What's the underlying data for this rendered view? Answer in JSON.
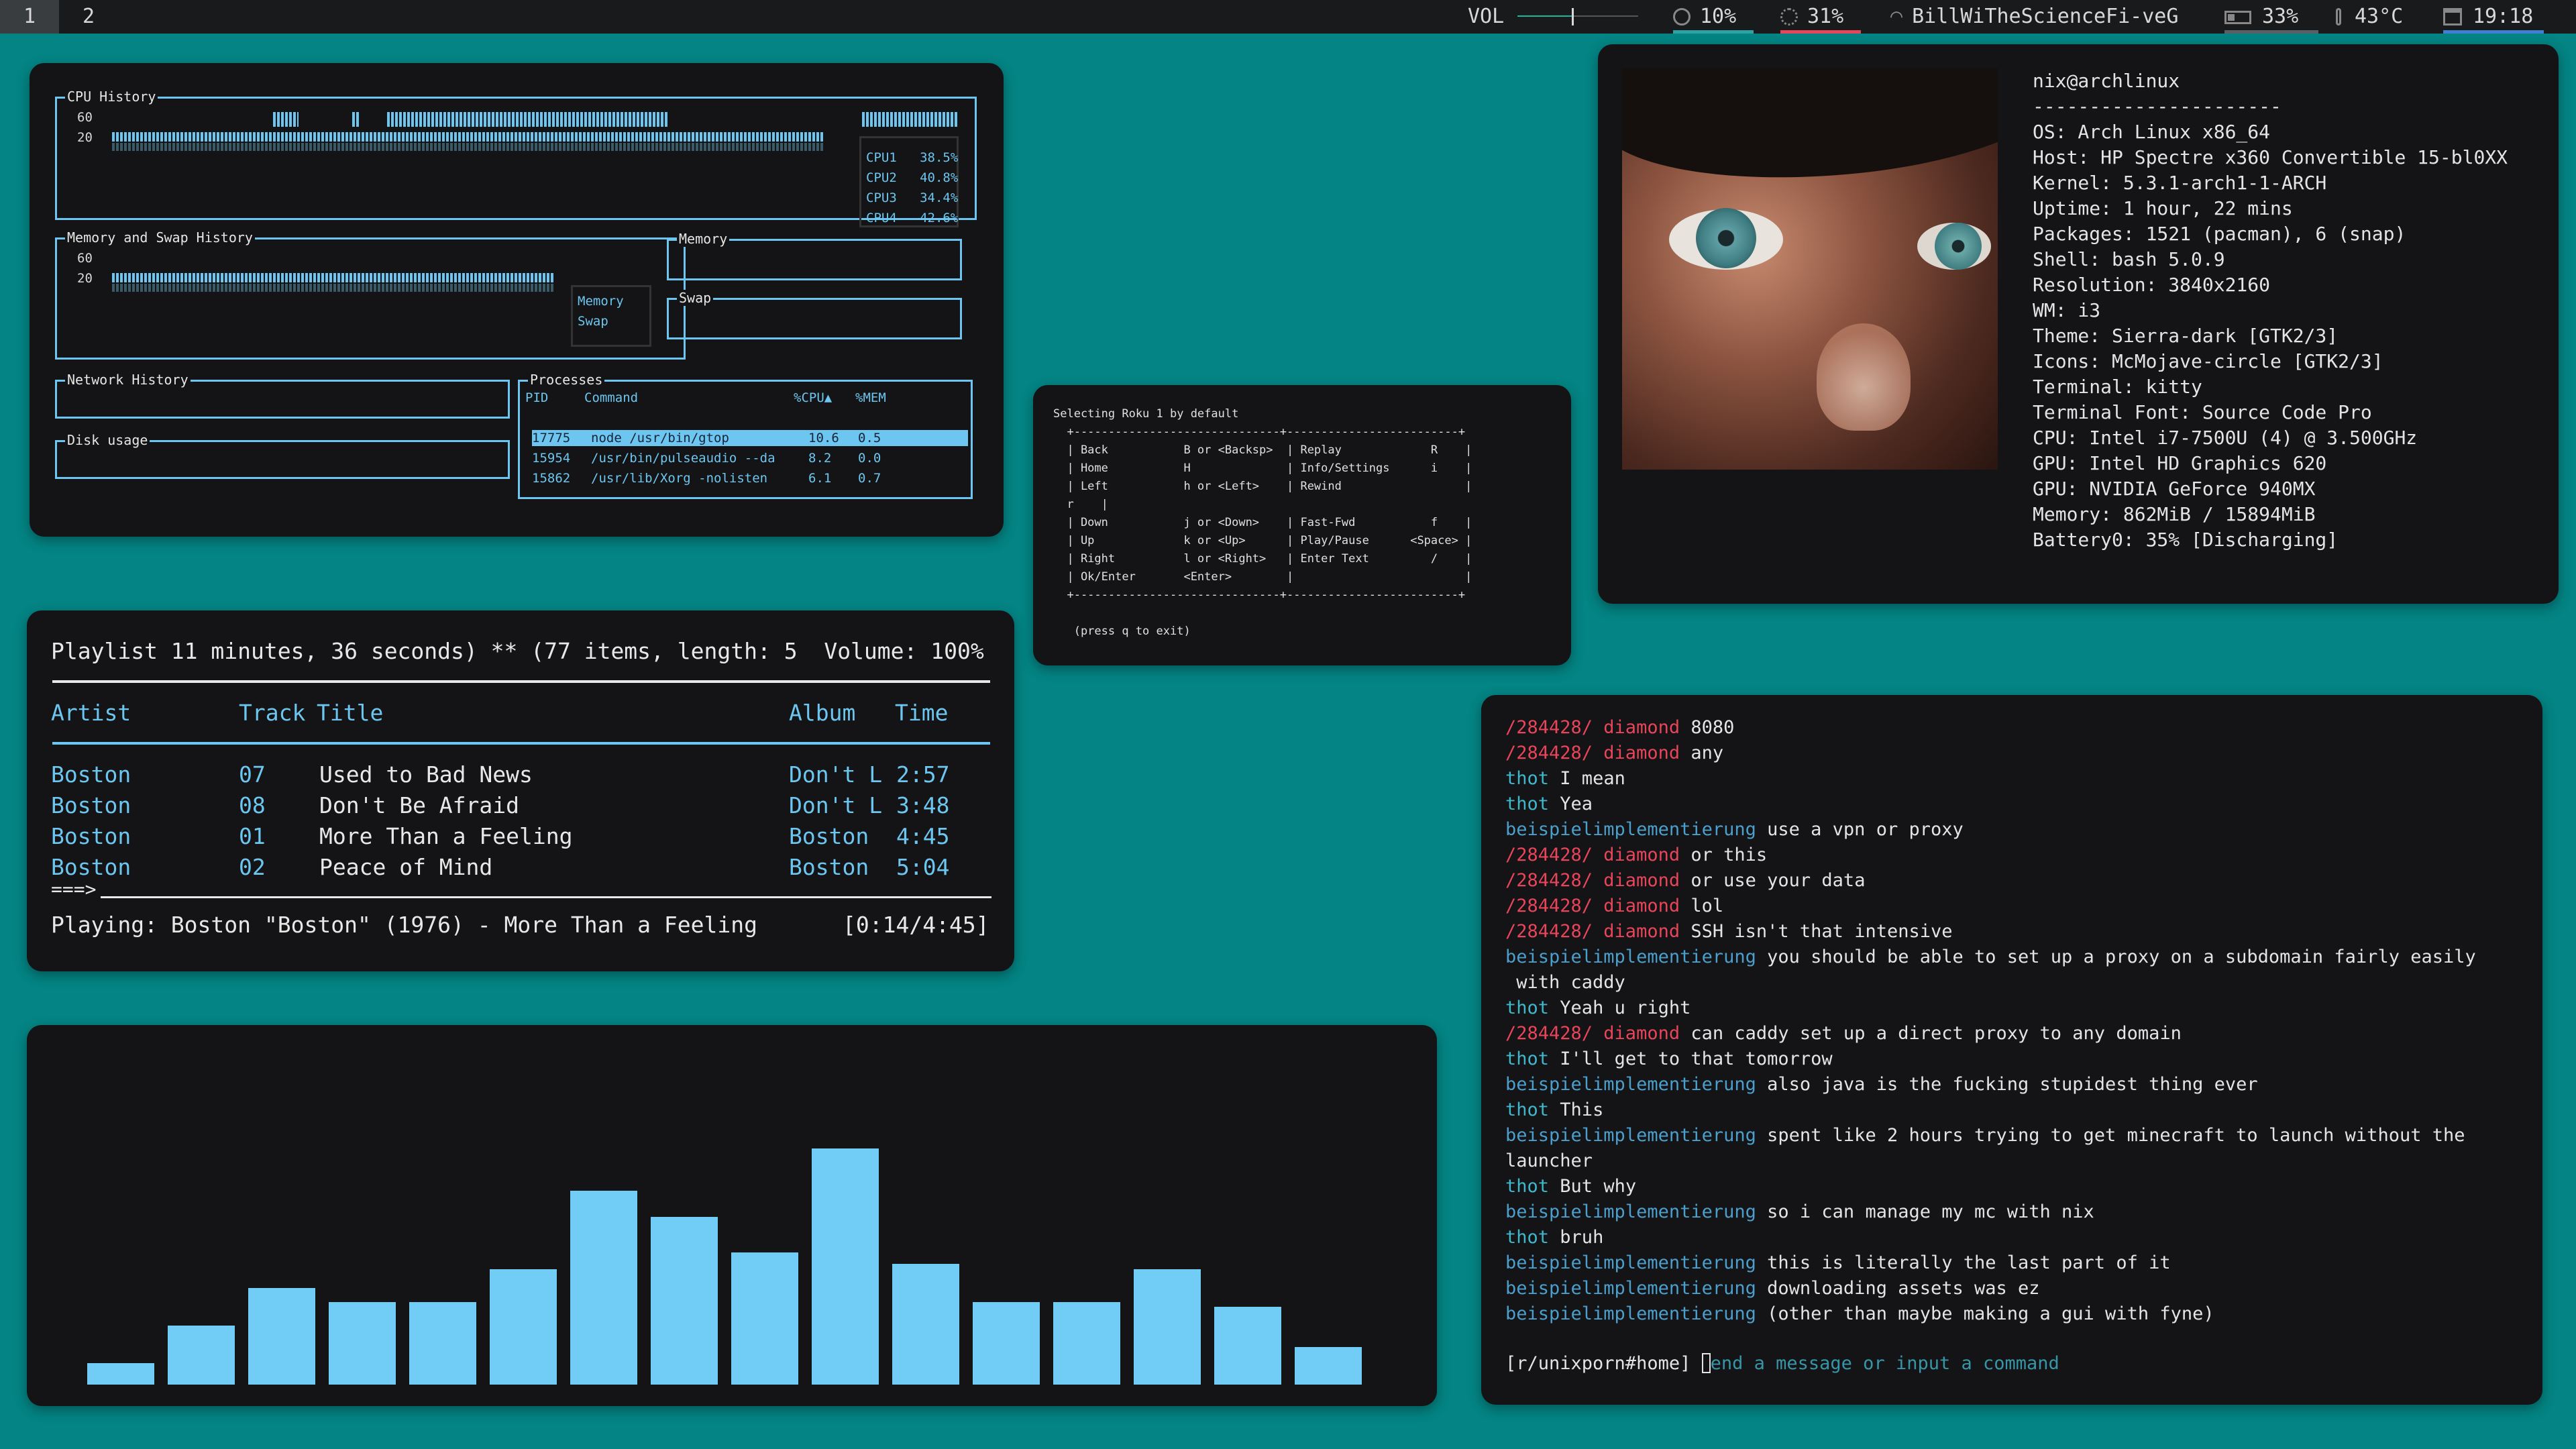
{
  "bar": {
    "workspaces": [
      "1",
      "2"
    ],
    "vol_label": "VOL",
    "vol_level": 0.45,
    "cpu": "10%",
    "mem": "31%",
    "wifi": "BillWiTheScienceFi-veG",
    "battery": "33%",
    "temp": "43°C",
    "clock": "19:18",
    "icons": [
      "volume-slider",
      "cpu-icon",
      "memory-icon",
      "wifi-icon",
      "battery-icon",
      "thermometer-icon",
      "calendar-icon"
    ],
    "colors": {
      "cpu": "#2ea3a3",
      "mem": "#e8455a",
      "battery": "#5a5f64",
      "clock": "#3f7fd0"
    }
  },
  "gtop": {
    "cpu_history_title": "CPU History",
    "y_labels": [
      "60",
      "20"
    ],
    "cpus": [
      {
        "name": "CPU1",
        "value": "38.5%"
      },
      {
        "name": "CPU2",
        "value": "40.8%"
      },
      {
        "name": "CPU3",
        "value": "34.4%"
      },
      {
        "name": "CPU4",
        "value": "42.6%"
      }
    ],
    "mem_history_title": "Memory and Swap History",
    "mem_legend": [
      "Memory",
      "Swap"
    ],
    "memory_title": "Memory",
    "swap_title": "Swap",
    "network_title": "Network History",
    "disk_title": "Disk usage",
    "processes_title": "Processes",
    "proc_headers": {
      "pid": "PID",
      "command": "Command",
      "cpu": "%CPU▲",
      "mem": "%MEM"
    },
    "processes": [
      {
        "pid": "17775",
        "command": "node /usr/bin/gtop",
        "cpu": "10.6",
        "mem": "0.5"
      },
      {
        "pid": "15954",
        "command": "/usr/bin/pulseaudio --da",
        "cpu": "8.2",
        "mem": "0.0"
      },
      {
        "pid": "15862",
        "command": "/usr/lib/Xorg -nolisten",
        "cpu": "6.1",
        "mem": "0.7"
      }
    ]
  },
  "roku": {
    "text": "Selecting Roku 1 by default\n  +------------------------------+-------------------------+\n  | Back           B or <Backsp>  | Replay             R    |\n  | Home           H              | Info/Settings      i    |\n  | Left           h or <Left>    | Rewind                  |\n  r    |\n  | Down           j or <Down>    | Fast-Fwd           f    |\n  | Up             k or <Up>      | Play/Pause      <Space> |\n  | Right          l or <Right>   | Enter Text         /    |\n  | Ok/Enter       <Enter>        |                         |\n  +------------------------------+-------------------------+\n\n   (press q to exit)"
  },
  "neofetch": {
    "user": "nix@archlinux",
    "separator": "----------------------",
    "lines": [
      "OS: Arch Linux x86_64",
      "Host: HP Spectre x360 Convertible 15-bl0XX",
      "Kernel: 5.3.1-arch1-1-ARCH",
      "Uptime: 1 hour, 22 mins",
      "Packages: 1521 (pacman), 6 (snap)",
      "Shell: bash 5.0.9",
      "Resolution: 3840x2160",
      "WM: i3",
      "Theme: Sierra-dark [GTK2/3]",
      "Icons: McMojave-circle [GTK2/3]",
      "Terminal: kitty",
      "Terminal Font: Source Code Pro",
      "CPU: Intel i7-7500U (4) @ 3.500GHz",
      "GPU: Intel HD Graphics 620",
      "GPU: NVIDIA GeForce 940MX",
      "Memory: 862MiB / 15894MiB",
      "Battery0: 35% [Discharging]"
    ]
  },
  "cmus": {
    "header": "Playlist 11 minutes, 36 seconds) ** (77 items, length: 5  Volume: 100%",
    "columns": {
      "artist": "Artist",
      "track": "Track",
      "title": "Title",
      "album": "Album",
      "time": "Time"
    },
    "tracks": [
      {
        "artist": "Boston",
        "track": "07",
        "title": "Used to Bad News",
        "album": "Don't L",
        "time": "2:57"
      },
      {
        "artist": "Boston",
        "track": "08",
        "title": "Don't Be Afraid",
        "album": "Don't L",
        "time": "3:48"
      },
      {
        "artist": "Boston",
        "track": "01",
        "title": "More Than a Feeling",
        "album": "Boston",
        "time": "4:45"
      },
      {
        "artist": "Boston",
        "track": "02",
        "title": "Peace of Mind",
        "album": "Boston",
        "time": "5:04"
      }
    ],
    "progress_marker": "===>",
    "playing": "Playing: Boston \"Boston\" (1976) - More Than a Feeling",
    "position": "[0:14/4:45]"
  },
  "chat": {
    "messages": [
      {
        "nick": "/284428/ diamond",
        "type": "a",
        "text": "8080"
      },
      {
        "nick": "/284428/ diamond",
        "type": "a",
        "text": "any"
      },
      {
        "nick": "thot",
        "type": "b",
        "text": "I mean"
      },
      {
        "nick": "thot",
        "type": "b",
        "text": "Yea"
      },
      {
        "nick": "beispielimplementierung",
        "type": "c",
        "text": "use a vpn or proxy"
      },
      {
        "nick": "/284428/ diamond",
        "type": "a",
        "text": "or this"
      },
      {
        "nick": "/284428/ diamond",
        "type": "a",
        "text": "or use your data"
      },
      {
        "nick": "/284428/ diamond",
        "type": "a",
        "text": "lol"
      },
      {
        "nick": "/284428/ diamond",
        "type": "a",
        "text": "SSH isn't that intensive"
      },
      {
        "nick": "beispielimplementierung",
        "type": "c",
        "text": "you should be able to set up a proxy on a subdomain fairly easily"
      },
      {
        "nick": "",
        "type": "cont",
        "text": " with caddy"
      },
      {
        "nick": "thot",
        "type": "b",
        "text": "Yeah u right"
      },
      {
        "nick": "/284428/ diamond",
        "type": "a",
        "text": "can caddy set up a direct proxy to any domain"
      },
      {
        "nick": "thot",
        "type": "b",
        "text": "I'll get to that tomorrow"
      },
      {
        "nick": "beispielimplementierung",
        "type": "c",
        "text": "also java is the fucking stupidest thing ever"
      },
      {
        "nick": "thot",
        "type": "b",
        "text": "This"
      },
      {
        "nick": "beispielimplementierung",
        "type": "c",
        "text": "spent like 2 hours trying to get minecraft to launch without the"
      },
      {
        "nick": "",
        "type": "cont",
        "text": "launcher"
      },
      {
        "nick": "thot",
        "type": "b",
        "text": "But why"
      },
      {
        "nick": "beispielimplementierung",
        "type": "c",
        "text": "so i can manage my mc with nix"
      },
      {
        "nick": "thot",
        "type": "b",
        "text": "bruh"
      },
      {
        "nick": "beispielimplementierung",
        "type": "c",
        "text": "this is literally the last part of it"
      },
      {
        "nick": "beispielimplementierung",
        "type": "c",
        "text": "downloading assets was ez"
      },
      {
        "nick": "beispielimplementierung",
        "type": "c",
        "text": "(other than maybe making a gui with fyne)"
      }
    ],
    "channel": "[r/unixporn#home]",
    "input_placeholder": "end a message or input a command"
  },
  "visualizer": {
    "levels": [
      0.09,
      0.25,
      0.41,
      0.35,
      0.35,
      0.49,
      0.82,
      0.71,
      0.56,
      1.0,
      0.51,
      0.35,
      0.35,
      0.49,
      0.33,
      0.16
    ]
  }
}
